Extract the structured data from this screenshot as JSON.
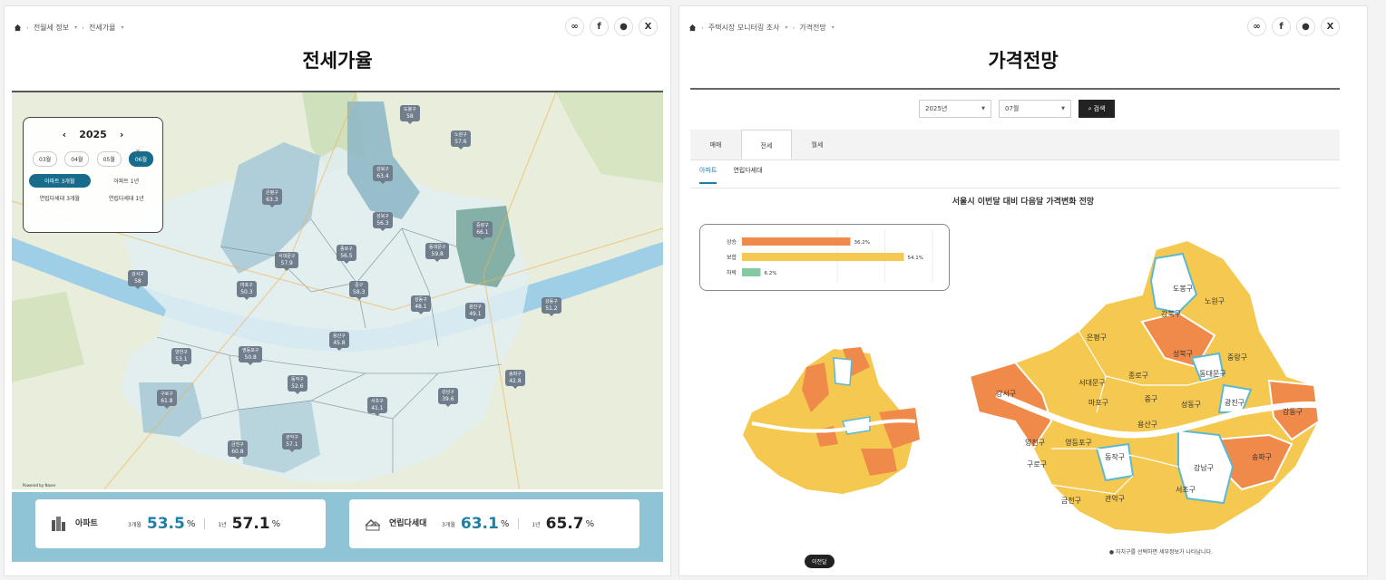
{
  "left": {
    "breadcrumb": [
      "전월세 정보",
      "전세가율"
    ],
    "title": "전세가율",
    "widget": {
      "year": "2025",
      "months": [
        "03월",
        "04월",
        "05월",
        "06월"
      ],
      "selected_month": "06월",
      "types": [
        "아파트 3개월",
        "아파트 1년",
        "연립다세대 3개월",
        "연립다세대 1년"
      ],
      "selected_type": "아파트 3개월"
    },
    "pins": [
      {
        "name": "도봉구",
        "value": "58"
      },
      {
        "name": "노원구",
        "value": "57.6"
      },
      {
        "name": "강북구",
        "value": "63.4"
      },
      {
        "name": "은평구",
        "value": "63.3"
      },
      {
        "name": "성북구",
        "value": "56.3"
      },
      {
        "name": "중랑구",
        "value": "66.1"
      },
      {
        "name": "서대문구",
        "value": "57.9"
      },
      {
        "name": "종로구",
        "value": "56.5"
      },
      {
        "name": "동대문구",
        "value": "59.8"
      },
      {
        "name": "강서구",
        "value": "58"
      },
      {
        "name": "마포구",
        "value": "50.3"
      },
      {
        "name": "중구",
        "value": "58.3"
      },
      {
        "name": "성동구",
        "value": "48.1"
      },
      {
        "name": "광진구",
        "value": "49.1"
      },
      {
        "name": "강동구",
        "value": "51.2"
      },
      {
        "name": "용산구",
        "value": "45.8"
      },
      {
        "name": "양천구",
        "value": "53.1"
      },
      {
        "name": "영등포구",
        "value": "50.8"
      },
      {
        "name": "동작구",
        "value": "52.6"
      },
      {
        "name": "송파구",
        "value": "42.8"
      },
      {
        "name": "서초구",
        "value": "41.1"
      },
      {
        "name": "강남구",
        "value": "39.6"
      },
      {
        "name": "구로구",
        "value": "61.8"
      },
      {
        "name": "금천구",
        "value": "60.8"
      },
      {
        "name": "관악구",
        "value": "57.1"
      }
    ],
    "map_credit": "Powered by Naver",
    "cards": {
      "apt": {
        "name": "아파트",
        "label_3m": "3개월",
        "value_3m": "53.5",
        "label_1y": "1년",
        "value_1y": "57.1",
        "unit": "%"
      },
      "villa": {
        "name": "연립다세대",
        "label_3m": "3개월",
        "value_3m": "63.1",
        "label_1y": "1년",
        "value_1y": "65.7",
        "unit": "%"
      }
    }
  },
  "right": {
    "breadcrumb": [
      "주택시장 모니터링 조사",
      "가격전망"
    ],
    "title": "가격전망",
    "filters": {
      "year": "2025년",
      "month": "07월",
      "search": "검색"
    },
    "tabs": [
      "매매",
      "전세",
      "월세"
    ],
    "active_tab": "전세",
    "subtabs": [
      "아파트",
      "연립다세대"
    ],
    "active_subtab": "아파트",
    "chart_title": "서울시 이번달 대비 다음달 가격변화 전망",
    "chart_data": {
      "type": "bar",
      "categories": [
        "상승",
        "보합",
        "하락"
      ],
      "values": [
        36.2,
        54.1,
        6.2
      ],
      "labels": [
        "36.2%",
        "54.1%",
        "6.2%"
      ],
      "colors": [
        "#f08a4b",
        "#f5c850",
        "#84c9a1"
      ],
      "xlim": [
        0,
        100
      ]
    },
    "districts": [
      "도봉구",
      "노원구",
      "강북구",
      "은평구",
      "성북구",
      "중랑구",
      "서대문구",
      "종로구",
      "동대문구",
      "강서구",
      "마포구",
      "중구",
      "성동구",
      "광진구",
      "강동구",
      "용산구",
      "양천구",
      "영등포구",
      "동작구",
      "송파구",
      "구로구",
      "서초구",
      "강남구",
      "금천구",
      "관악구"
    ],
    "note": "● 자치구를 선택하면 세부정보가 나타납니다.",
    "mini_button": "이전달",
    "colors": {
      "rise": "#f08a4b",
      "flat": "#f5c850",
      "fall": "#ffffff",
      "outline_fall": "#5bb9d3"
    }
  },
  "share_icons": [
    "link-icon",
    "facebook-icon",
    "talk-icon",
    "x-icon"
  ]
}
